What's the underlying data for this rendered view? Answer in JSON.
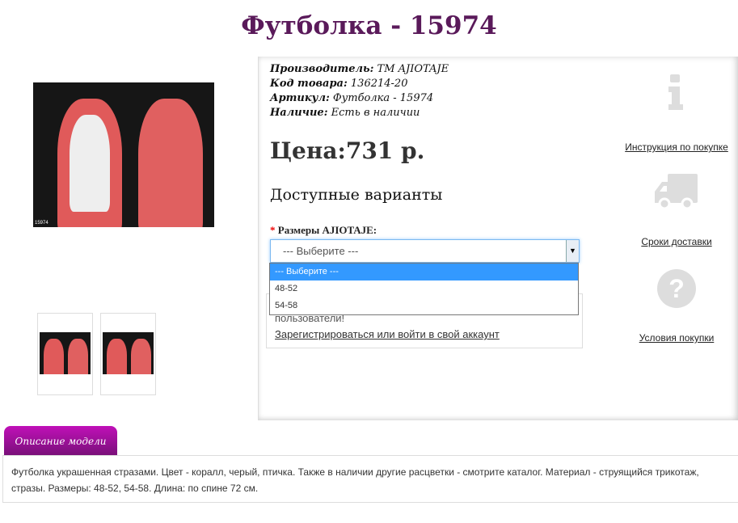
{
  "title": "Футболка - 15974",
  "product_image": {
    "label": "15974"
  },
  "info": [
    {
      "label": "Производитель:",
      "value": " ТМ AJIOTAJE"
    },
    {
      "label": "Код товара:",
      "value": " 136214-20"
    },
    {
      "label": "Артикул:",
      "value": " Футболка - 15974"
    },
    {
      "label": "Наличие:",
      "value": " Есть в наличии"
    }
  ],
  "price": "Цена:731 р.",
  "variants_title": "Доступные варианты",
  "size_label": "Размеры AJIOTAJE:",
  "required_mark": "*",
  "select": {
    "value": "--- Выберите ---",
    "options": [
      "--- Выберите ---",
      "48-52",
      "54-58"
    ]
  },
  "register": {
    "text": "пользователи!",
    "link": "Зарегистрироваться или войти в свой аккаунт"
  },
  "side_links": [
    {
      "icon": "info-icon",
      "label": "Инструкция по покупке"
    },
    {
      "icon": "truck-icon",
      "label": "Сроки доставки"
    },
    {
      "icon": "question-icon",
      "label": "Условия покупки"
    }
  ],
  "tab_label": "Описание модели",
  "description": "Футболка украшенная стразами. Цвет - коралл, черый, птичка. Также в наличии другие расцветки - смотрите каталог. Материал - струящийся трикотаж, стразы. Размеры: 48-52, 54-58. Длина: по спине 72 см.",
  "colors": {
    "title": "#5a1a5a",
    "tab": "#b010b0",
    "selected": "#3399ff"
  }
}
